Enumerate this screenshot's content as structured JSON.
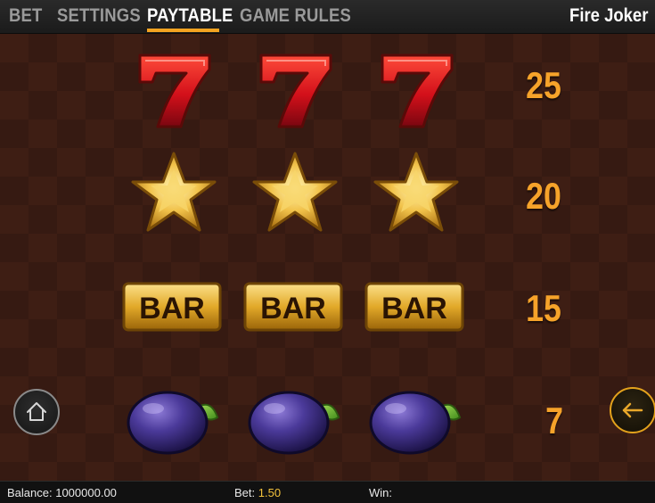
{
  "nav": {
    "tabs": [
      {
        "label": "BET",
        "active": false
      },
      {
        "label": "SETTINGS",
        "active": false
      },
      {
        "label": "PAYTABLE",
        "active": true
      },
      {
        "label": "GAME RULES",
        "active": false
      }
    ],
    "game_title": "Fire Joker"
  },
  "paytable": {
    "rows": [
      {
        "symbol": "seven-icon",
        "count": 3,
        "payout": "25"
      },
      {
        "symbol": "star-icon",
        "count": 3,
        "payout": "20"
      },
      {
        "symbol": "bar-icon",
        "count": 3,
        "payout": "15",
        "symbol_text": "BAR"
      },
      {
        "symbol": "plum-icon",
        "count": 3,
        "payout": "7"
      }
    ]
  },
  "controls": {
    "home_icon": "home-icon",
    "back_icon": "arrow-left-icon"
  },
  "status": {
    "balance_label": "Balance:",
    "balance_value": "1000000.00",
    "bet_label": "Bet:",
    "bet_value": "1.50",
    "win_label": "Win:",
    "win_value": ""
  },
  "colors": {
    "accent": "#f3a321",
    "payout": "#f6a32a",
    "background": "#3e1e14"
  }
}
